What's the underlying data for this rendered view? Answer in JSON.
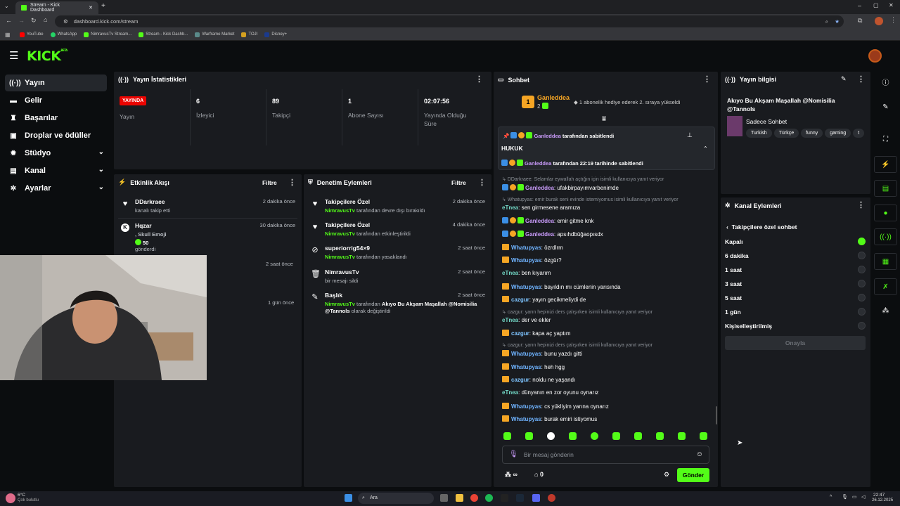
{
  "browser": {
    "tabs": [
      {
        "label": "Stream - Kick Dashboard"
      }
    ],
    "url": "dashboard.kick.com/stream",
    "bookmarks": [
      "YouTube",
      "WhatsApp",
      "NimravusTv Stream...",
      "Stream - Kick Dashb...",
      "Warframe Market",
      "TOJI",
      "Disney+"
    ]
  },
  "header": {
    "logo": "KICK",
    "logo_sup": "BETA"
  },
  "sidebar": {
    "items": [
      {
        "label": "Yayın",
        "icon": "broadcast-icon",
        "active": true
      },
      {
        "label": "Gelir",
        "icon": "money-icon"
      },
      {
        "label": "Başarılar",
        "icon": "trophy-icon"
      },
      {
        "label": "Droplar ve ödüller",
        "icon": "gift-icon"
      },
      {
        "label": "Stüdyo",
        "icon": "gear-icon",
        "expandable": true
      },
      {
        "label": "Kanal",
        "icon": "layers-icon",
        "expandable": true
      },
      {
        "label": "Ayarlar",
        "icon": "settings-icon",
        "expandable": true
      }
    ]
  },
  "stats": {
    "title": "Yayın İstatistikleri",
    "live_badge": "YAYINDA",
    "live_label": "Yayın",
    "items": [
      {
        "value": "6",
        "label": "İzleyici"
      },
      {
        "value": "89",
        "label": "Takipçi"
      },
      {
        "value": "1",
        "label": "Abone Sayısı"
      },
      {
        "value": "02:07:56",
        "label": "Yayında Olduğu Süre"
      }
    ]
  },
  "activity": {
    "title": "Etkinlik Akışı",
    "filter": "Filtre",
    "events": [
      {
        "user": "DDarkraee",
        "desc": "kanalı takip etti",
        "time": "2 dakika önce"
      },
      {
        "user": "Hqzar",
        "desc": ", Skull Emoji",
        "amount": "50",
        "sub": "gönderdi",
        "time": "30 dakika önce"
      },
      {
        "user": "",
        "desc": "",
        "time": "2 saat önce"
      },
      {
        "user": "",
        "desc": "",
        "time": "1 gün önce"
      }
    ]
  },
  "moderation": {
    "title": "Denetim Eylemleri",
    "filter": "Filtre",
    "events": [
      {
        "title": "Takipçilere Özel",
        "actor": "NimravusTv",
        "desc": "tarafından devre dışı bırakıldı",
        "time": "2 dakika önce"
      },
      {
        "title": "Takipçilere Özel",
        "actor": "NimravusTv",
        "desc": "tarafından etkinleştirildi",
        "time": "4 dakika önce"
      },
      {
        "title": "superiorrig54×9",
        "actor": "NimravusTv",
        "desc": "tarafından yasaklandı",
        "time": "2 saat önce"
      },
      {
        "title": "NimravusTv",
        "actor": "",
        "desc": "bir mesajı sildi",
        "time": "2 saat önce"
      },
      {
        "title": "Başlık",
        "actor": "NimravusTv",
        "desc": "tarafından",
        "desc2": "Akıyo Bu Akşam Maşallah @Nomisilia @Tannols",
        "desc3": "olarak değiştirildi",
        "time": "2 saat önce"
      }
    ]
  },
  "chat": {
    "title": "Sohbet",
    "gift_rank": "1",
    "gift_user": "Ganleddea",
    "gift_count": "2",
    "gift_text": "1 abonelik hediye ederek 2. sıraya yükseldi",
    "pinned_by": "Ganleddea",
    "pinned_by_suffix": "tarafından sabitlendi",
    "pinned_text": "HUKUK",
    "pinned_at_user": "Ganleddea",
    "pinned_at": "tarafından 22:19 tarihinde sabitlendi",
    "messages": [
      {
        "type": "reply",
        "text": "DDarkraee: Selamlar eywallah açtığın için isimli kullanıcıya yanıt veriyor"
      },
      {
        "type": "msg",
        "user": "Ganleddea",
        "badges": "mod",
        "text": "ufakbirpayımvarbenimde"
      },
      {
        "type": "reply",
        "text": "Whatupyas: emir burak seni evinde istemiyomus isimli kullanıcıya yanıt veriyor"
      },
      {
        "type": "msg",
        "user": "eTnea",
        "badges": "none",
        "text": "sen girmesene aramıza"
      },
      {
        "type": "msg",
        "user": "Ganleddea",
        "badges": "mod",
        "text": "emir gitme knk"
      },
      {
        "type": "msg",
        "user": "Ganleddea",
        "badges": "mod",
        "text": "apsıhdbüğaopısdx"
      },
      {
        "type": "msg",
        "user": "Whatupyas",
        "badges": "crown",
        "text": "özrdlrm"
      },
      {
        "type": "msg",
        "user": "Whatupyas",
        "badges": "crown",
        "text": "özgür?"
      },
      {
        "type": "msg",
        "user": "eTnea",
        "badges": "none",
        "text": "ben kıyarım"
      },
      {
        "type": "msg",
        "user": "Whatupyas",
        "badges": "crown",
        "text": "bayıldın mı cümlenin yarısında"
      },
      {
        "type": "msg",
        "user": "cazgur",
        "badges": "crown",
        "text": "yayın gecikmeliydi de"
      },
      {
        "type": "reply",
        "text": "cazgur: yarın hepinizi ders çalışırken isimli kullanıcıya yanıt veriyor"
      },
      {
        "type": "msg",
        "user": "eTnea",
        "badges": "none",
        "text": "der ve ekler"
      },
      {
        "type": "msg",
        "user": "cazgur",
        "badges": "crown",
        "text": "kapa aç yaptım"
      },
      {
        "type": "reply",
        "text": "cazgur: yarın hepinizi ders çalışırken isimli kullanıcıya yanıt veriyor"
      },
      {
        "type": "msg",
        "user": "Whatupyas",
        "badges": "crown",
        "text": "bunu yazdı gitti"
      },
      {
        "type": "msg",
        "user": "Whatupyas",
        "badges": "crown",
        "text": "heh hgg"
      },
      {
        "type": "msg",
        "user": "cazgur",
        "badges": "crown",
        "text": "noldu ne yaşandı"
      },
      {
        "type": "msg",
        "user": "eTnea",
        "badges": "none",
        "text": "dünyanın en zor oyunu oynarız"
      },
      {
        "type": "msg",
        "user": "Whatupyas",
        "badges": "crown",
        "text": "cs yükliyim yarına oynarız"
      },
      {
        "type": "msg",
        "user": "Whatupyas",
        "badges": "crown",
        "text": "burak emiri istiyomus"
      }
    ],
    "input_placeholder": "Bir mesaj gönderin",
    "points_symbol": "∞",
    "kicks_count": "0",
    "send_label": "Gönder"
  },
  "stream_info": {
    "title": "Yayın bilgisi",
    "stream_title": "Akıyo Bu Akşam Maşallah @Nomisilia @Tannols",
    "category": "Sadece Sohbet",
    "tags": [
      "Turkish",
      "Türkçe",
      "funny",
      "gaming",
      "t"
    ]
  },
  "channel_actions": {
    "title": "Kanal Eylemleri",
    "back_label": "Takipçilere özel sohbet",
    "options": [
      "Kapalı",
      "6 dakika",
      "1 saat",
      "3 saat",
      "5 saat",
      "1 gün",
      "Kişiselleştirilmiş"
    ],
    "selected": 0,
    "confirm_label": "Onayla"
  },
  "taskbar": {
    "weather_temp": "6°C",
    "weather_desc": "Çok bulutlu",
    "search": "Ara",
    "time": "22:47",
    "date": "26.12.2025"
  },
  "colors": {
    "brand": "#53fc18",
    "live": "#eb0400",
    "panel": "#191b1f"
  }
}
